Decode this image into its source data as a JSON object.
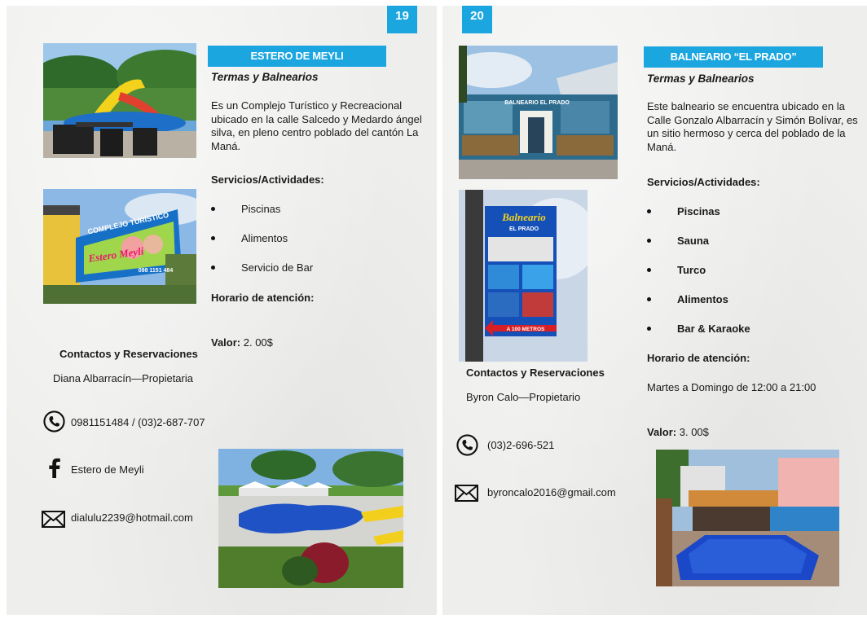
{
  "page19": {
    "number": "19",
    "title": "ESTERO DE MEYLI",
    "category": "Termas y Balnearios",
    "description": "Es un Complejo Turístico y Recreacional ubicado en la calle Salcedo y Medardo ángel silva, en pleno centro poblado del cantón La Maná.",
    "services_heading": "Servicios/Actividades:",
    "services": [
      "Piscinas",
      "Alimentos",
      "Servicio de Bar"
    ],
    "hours_heading": "Horario de atención:",
    "value_label": "Valor:",
    "value": "2. 00$",
    "contacts_heading": "Contactos y Reservaciones",
    "owner": "Diana Albarracín—Propietaria",
    "phone": "0981151484 / (03)2-687-707",
    "facebook": "Estero de Meyli",
    "email": "dialulu2239@hotmail.com",
    "sign_title": "COMPLEJO TURÍSTICO",
    "sign_name": "Estero Meyli",
    "sign_phone": "098 1151 484",
    "icons": [
      "phone-icon",
      "facebook-icon",
      "mail-icon"
    ]
  },
  "page20": {
    "number": "20",
    "title": "BALNEARIO “EL PRADO”",
    "category": "Termas y Balnearios",
    "description": "Este balneario se encuentra ubicado en la Calle Gonzalo Albarracín y Simón Bolívar, es un sitio hermoso y cerca del poblado de la Maná.",
    "services_heading": "Servicios/Actividades:",
    "services": [
      "Piscinas",
      "Sauna",
      "Turco",
      "Alimentos",
      "Bar & Karaoke"
    ],
    "hours_heading": "Horario de atención:",
    "hours": "Martes a Domingo de 12:00 a 21:00",
    "value_label": "Valor:",
    "value": "3. 00$",
    "contacts_heading": "Contactos y Reservaciones",
    "owner": "Byron Calo—Propietario",
    "phone": "(03)2-696-521",
    "email": "byroncalo2016@gmail.com",
    "facade_sign": "BALNEARIO EL PRADO",
    "sign_title": "Balneario",
    "sign_subtitle": "EL PRADO",
    "sign_arrow": "A 100 METROS",
    "icons": [
      "phone-icon",
      "mail-icon"
    ]
  },
  "colors": {
    "accent": "#1ba6e0",
    "paper": "#eeeeec",
    "text": "#1a1a1a"
  }
}
